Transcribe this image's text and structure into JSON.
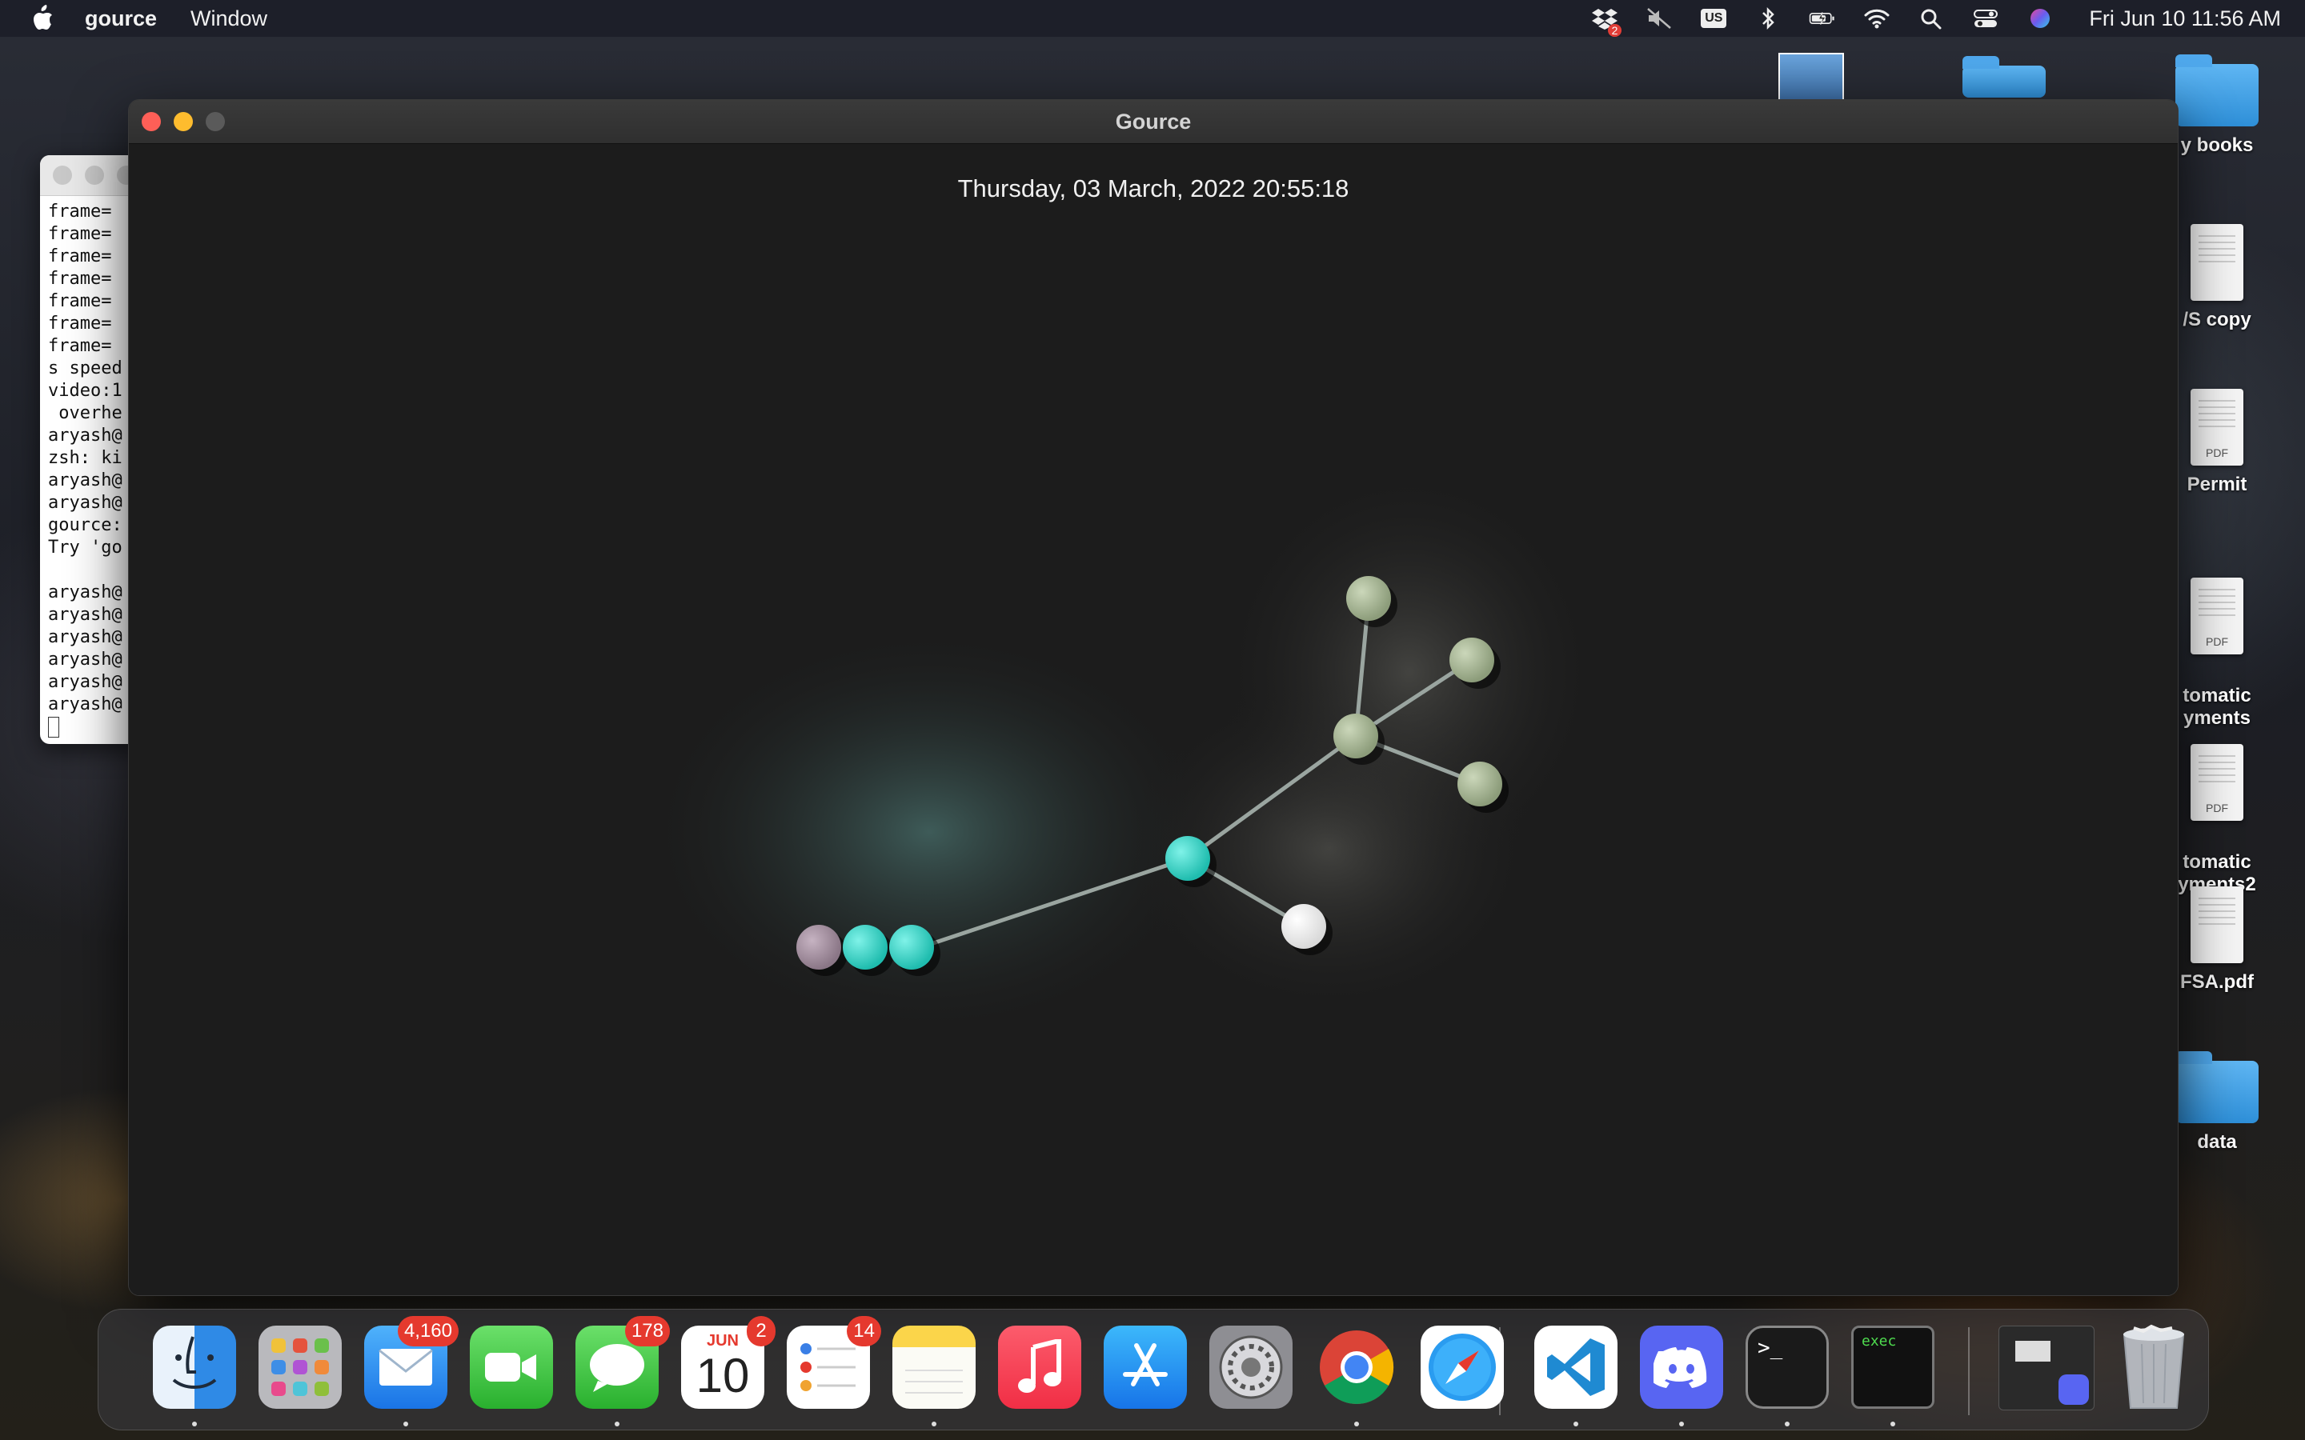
{
  "menubar": {
    "app_name": "gource",
    "menus": [
      "Window"
    ],
    "status": {
      "dropbox_count": "2",
      "input_source": "US",
      "clock": "Fri Jun 10  11:56 AM"
    }
  },
  "desktop": {
    "items": [
      {
        "label": "y books",
        "kind": "folder"
      },
      {
        "label": "/S copy",
        "kind": "document"
      },
      {
        "label": "Permit",
        "kind": "pdf"
      },
      {
        "label": "tomatic\nyments",
        "kind": "pdf"
      },
      {
        "label": "tomatic\nyments2",
        "kind": "pdf"
      },
      {
        "label": "FSA.pdf",
        "kind": "document"
      },
      {
        "label": "data",
        "kind": "folder"
      }
    ]
  },
  "terminal": {
    "lines": [
      "frame=",
      "frame=",
      "frame=",
      "frame=",
      "frame=",
      "frame=",
      "frame=",
      "s speed",
      "video:1",
      " overhe",
      "aryash@",
      "zsh: ki",
      "aryash@",
      "aryash@",
      "gource:",
      "Try 'go",
      "",
      "aryash@",
      "aryash@",
      "aryash@",
      "aryash@",
      "aryash@",
      "aryash@"
    ]
  },
  "gource": {
    "window_title": "Gource",
    "timestamp": "Thursday, 03 March, 2022 20:55:18",
    "colors": {
      "cyan": "#2fd6c8",
      "sage": "#a9b799",
      "white": "#ffffff",
      "mauve": "#a893a4",
      "edge": "#9aa5a0"
    }
  },
  "dock": {
    "apps": [
      {
        "name": "Finder",
        "icon": "finder-icon",
        "badge": "",
        "running": true
      },
      {
        "name": "Launchpad",
        "icon": "launchpad-icon",
        "badge": "",
        "running": false
      },
      {
        "name": "Mail",
        "icon": "mail-icon",
        "badge": "4,160",
        "running": true
      },
      {
        "name": "FaceTime",
        "icon": "facetime-icon",
        "badge": "",
        "running": false
      },
      {
        "name": "Messages",
        "icon": "messages-icon",
        "badge": "178",
        "running": true
      },
      {
        "name": "Calendar",
        "icon": "calendar-icon",
        "badge": "2",
        "running": false,
        "month": "JUN",
        "day": "10"
      },
      {
        "name": "Reminders",
        "icon": "reminders-icon",
        "badge": "14",
        "running": false
      },
      {
        "name": "Notes",
        "icon": "notes-icon",
        "badge": "",
        "running": true
      },
      {
        "name": "Music",
        "icon": "music-icon",
        "badge": "",
        "running": false
      },
      {
        "name": "App Store",
        "icon": "app-store-icon",
        "badge": "",
        "running": false
      },
      {
        "name": "System Preferences",
        "icon": "gear-icon",
        "badge": "",
        "running": false
      },
      {
        "name": "Chrome",
        "icon": "chrome-icon",
        "badge": "",
        "running": true
      },
      {
        "name": "Safari",
        "icon": "safari-icon",
        "badge": "",
        "running": false
      },
      {
        "name": "VS Code",
        "icon": "vscode-icon",
        "badge": "",
        "running": true
      },
      {
        "name": "Discord",
        "icon": "discord-icon",
        "badge": "",
        "running": true
      },
      {
        "name": "Terminal",
        "icon": "terminal-icon",
        "badge": "",
        "running": true
      },
      {
        "name": "exec",
        "icon": "exec-icon",
        "badge": "",
        "running": true,
        "label": "exec"
      }
    ]
  }
}
